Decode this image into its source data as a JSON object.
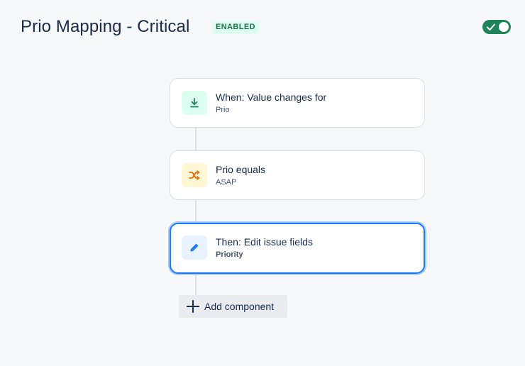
{
  "header": {
    "title": "Prio Mapping - Critical",
    "status_badge": "ENABLED",
    "toggle_on": true
  },
  "colors": {
    "accent": "#1d7afc",
    "enabled_green": "#1f845a",
    "trigger_bg": "#dcfff1",
    "condition_bg": "#fff7d6",
    "action_bg": "#e9f2ff"
  },
  "components": [
    {
      "icon": "download-arrow-icon",
      "title": "When: Value changes for",
      "subtitle": "Prio"
    },
    {
      "icon": "shuffle-icon",
      "title": "Prio equals",
      "subtitle": "ASAP"
    },
    {
      "icon": "pencil-icon",
      "title": "Then: Edit issue fields",
      "subtitle": "Priority"
    }
  ],
  "add_component": {
    "label": "Add component",
    "icon": "plus-icon"
  }
}
